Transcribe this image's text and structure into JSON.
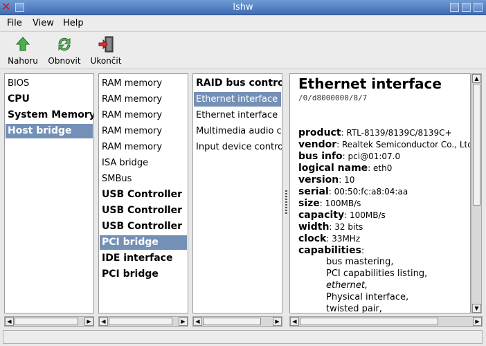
{
  "window": {
    "title": "lshw"
  },
  "menu": [
    {
      "label": "File"
    },
    {
      "label": "View"
    },
    {
      "label": "Help"
    }
  ],
  "toolbar": {
    "up": "Nahoru",
    "refresh": "Obnovit",
    "quit": "Ukončit"
  },
  "col1": [
    {
      "label": "BIOS",
      "bold": false,
      "selected": false
    },
    {
      "label": "CPU",
      "bold": true,
      "selected": false
    },
    {
      "label": "System Memory",
      "bold": true,
      "selected": false
    },
    {
      "label": "Host bridge",
      "bold": true,
      "selected": true
    }
  ],
  "col2": [
    {
      "label": "RAM memory",
      "bold": false,
      "selected": false
    },
    {
      "label": "RAM memory",
      "bold": false,
      "selected": false
    },
    {
      "label": "RAM memory",
      "bold": false,
      "selected": false
    },
    {
      "label": "RAM memory",
      "bold": false,
      "selected": false
    },
    {
      "label": "RAM memory",
      "bold": false,
      "selected": false
    },
    {
      "label": "ISA bridge",
      "bold": false,
      "selected": false
    },
    {
      "label": "SMBus",
      "bold": false,
      "selected": false
    },
    {
      "label": "USB Controller",
      "bold": true,
      "selected": false
    },
    {
      "label": "USB Controller",
      "bold": true,
      "selected": false
    },
    {
      "label": "USB Controller",
      "bold": true,
      "selected": false
    },
    {
      "label": "PCI bridge",
      "bold": true,
      "selected": true
    },
    {
      "label": "IDE interface",
      "bold": true,
      "selected": false
    },
    {
      "label": "PCI bridge",
      "bold": true,
      "selected": false
    }
  ],
  "col3": [
    {
      "label": "RAID bus controller",
      "bold": true,
      "selected": false
    },
    {
      "label": "Ethernet interface",
      "bold": false,
      "selected": true
    },
    {
      "label": "Ethernet interface",
      "bold": false,
      "selected": false
    },
    {
      "label": "Multimedia audio controller",
      "bold": false,
      "selected": false
    },
    {
      "label": "Input device controller",
      "bold": false,
      "selected": false
    }
  ],
  "detail": {
    "title": "Ethernet interface",
    "path": "/0/d8000000/8/7",
    "props": [
      {
        "key": "product",
        "value": "RTL-8139/8139C/8139C+"
      },
      {
        "key": "vendor",
        "value": "Realtek Semiconductor Co., Ltd."
      },
      {
        "key": "bus info",
        "value": "pci@01:07.0"
      },
      {
        "key": "logical name",
        "value": "eth0"
      },
      {
        "key": "version",
        "value": "10"
      },
      {
        "key": "serial",
        "value": "00:50:fc:a8:04:aa"
      },
      {
        "key": "size",
        "value": "100MB/s"
      },
      {
        "key": "capacity",
        "value": "100MB/s"
      },
      {
        "key": "width",
        "value": "32 bits"
      },
      {
        "key": "clock",
        "value": "33MHz"
      },
      {
        "key": "capabilities",
        "value": ""
      }
    ],
    "capabilities": [
      {
        "text": "bus mastering,",
        "italic": false
      },
      {
        "text": "PCI capabilities listing,",
        "italic": false
      },
      {
        "text": "ethernet,",
        "italic": true
      },
      {
        "text": "Physical interface,",
        "italic": false
      },
      {
        "text": "twisted pair,",
        "italic": false
      }
    ]
  },
  "colors": {
    "selection": "#7390b6",
    "titlebar": "#4f7cc0"
  }
}
